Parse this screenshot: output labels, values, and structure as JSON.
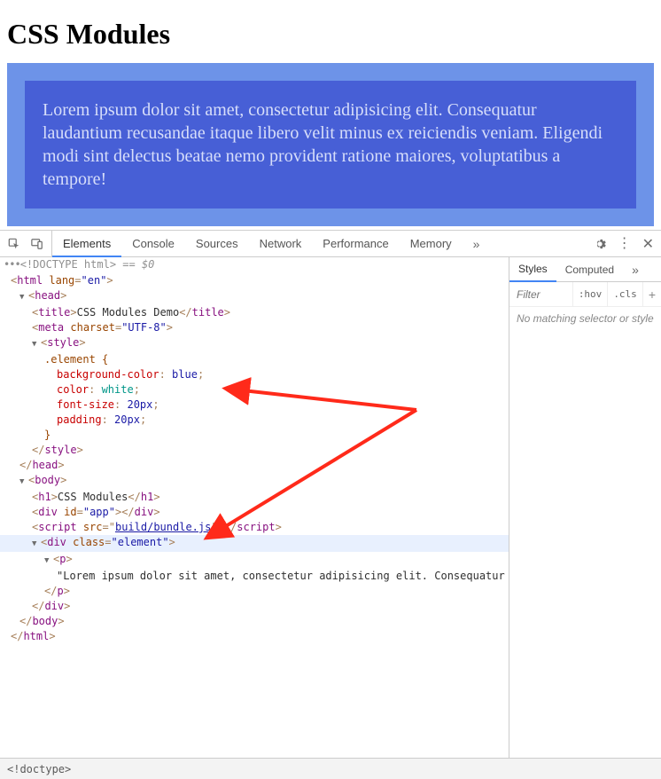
{
  "page": {
    "heading": "CSS Modules",
    "paragraph": "Lorem ipsum dolor sit amet, consectetur adipisicing elit. Consequatur laudantium recusandae itaque libero velit minus ex reiciendis veniam. Eligendi modi sint delectus beatae nemo provident ratione maiores, voluptatibus a tempore!"
  },
  "devtools": {
    "tabs": [
      "Elements",
      "Console",
      "Sources",
      "Network",
      "Performance",
      "Memory"
    ],
    "overflow": "»",
    "styles_tabs": [
      "Styles",
      "Computed"
    ],
    "filter_placeholder": "Filter",
    "hov_label": ":hov",
    "cls_label": ".cls",
    "plus_label": "+",
    "no_match": "No matching selector or style",
    "breadcrumb": "<!doctype>"
  },
  "dom": {
    "doctype_line": "<!DOCTYPE html>",
    "eq0": " == $0",
    "lang_attr": "lang",
    "lang_val": "\"en\"",
    "title_text": "CSS Modules Demo",
    "charset_attr": "charset",
    "charset_val": "\"UTF-8\"",
    "css_selector": ".element {",
    "css_bg_prop": "background-color",
    "css_bg_val": "blue",
    "css_color_prop": "color",
    "css_color_val": "white",
    "css_fs_prop": "font-size",
    "css_fs_val": "20px",
    "css_pad_prop": "padding",
    "css_pad_val": "20px",
    "css_close": "}",
    "h1_text": "CSS Modules",
    "id_attr": "id",
    "id_val": "\"app\"",
    "src_attr": "src",
    "src_val": "build/bundle.js",
    "class_attr": "class",
    "class_val": "\"element\"",
    "p_text": "\"Lorem ipsum dolor sit amet, consectetur adipisicing elit. Consequatur laudantium recusandae itaque libero velit minus ex reiciendis veniam. Eligendi modi sint delectus beatae nemo provident ratione maiores, voluptatibus a tempore!\""
  }
}
